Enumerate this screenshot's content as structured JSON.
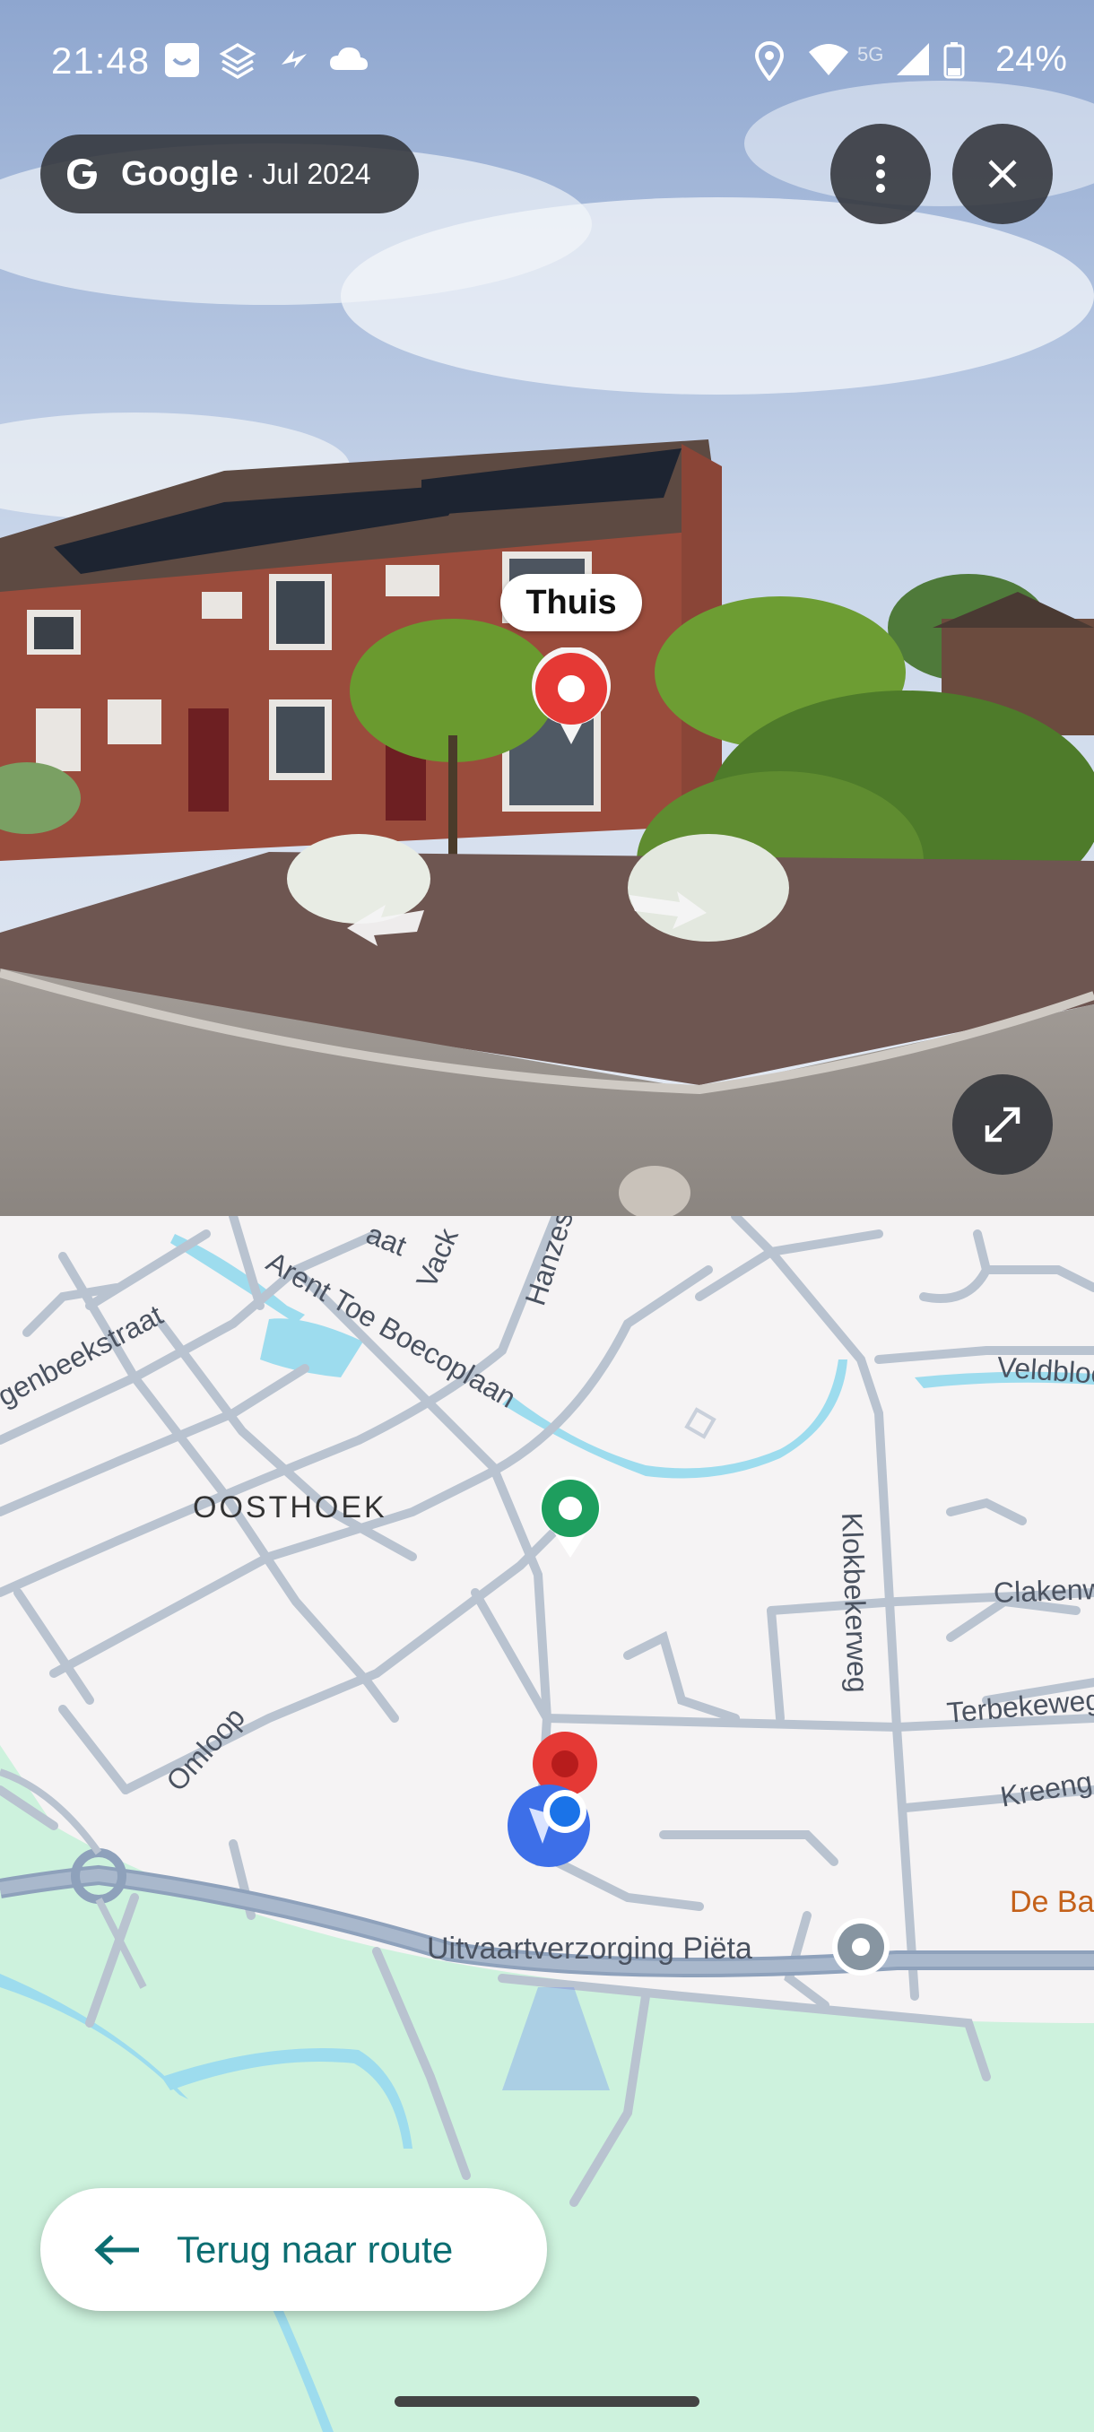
{
  "status_bar": {
    "time": "21:48",
    "battery": "24%",
    "network": "5G",
    "icons": [
      "notification-icon",
      "layers-icon",
      "bolt-icon",
      "cloud-icon",
      "location-icon",
      "wifi-icon",
      "signal-icon",
      "battery-icon"
    ]
  },
  "street_view": {
    "provider": "Google",
    "separator": "·",
    "capture_date": "Jul 2024",
    "place_label": "Thuis",
    "buttons": [
      "more-options-button",
      "close-button",
      "expand-button"
    ]
  },
  "map": {
    "district": "OOSTHOEK",
    "road_labels": {
      "arent_toe_boecoplaan": "Arent Toe Boecoplaan",
      "hanzestraat": "Hanzest",
      "vack": "Vack",
      "beeksstraat": "genbeekstraat",
      "omloop": "Omloop",
      "klokbekerweg": "Klokbekerweg",
      "clakenw": "Clakenw",
      "terbekeweg": "Terbekeweg",
      "kreeng": "Kreeng",
      "veldbloe": "Veldbloe",
      "lat": "aat"
    },
    "poi_label": "Uitvaartverzorging Piëta",
    "poi_partial": "De Ba",
    "colors": {
      "water": "#9ddcee",
      "green": "#cdf2dd",
      "road": "#b9c3d0",
      "major_road": "#8ea1bb",
      "pin_red": "#e53935",
      "pin_green": "#1e9e5e",
      "location_blue": "#1a73e8"
    }
  },
  "route_button": {
    "label": "Terug naar route"
  }
}
